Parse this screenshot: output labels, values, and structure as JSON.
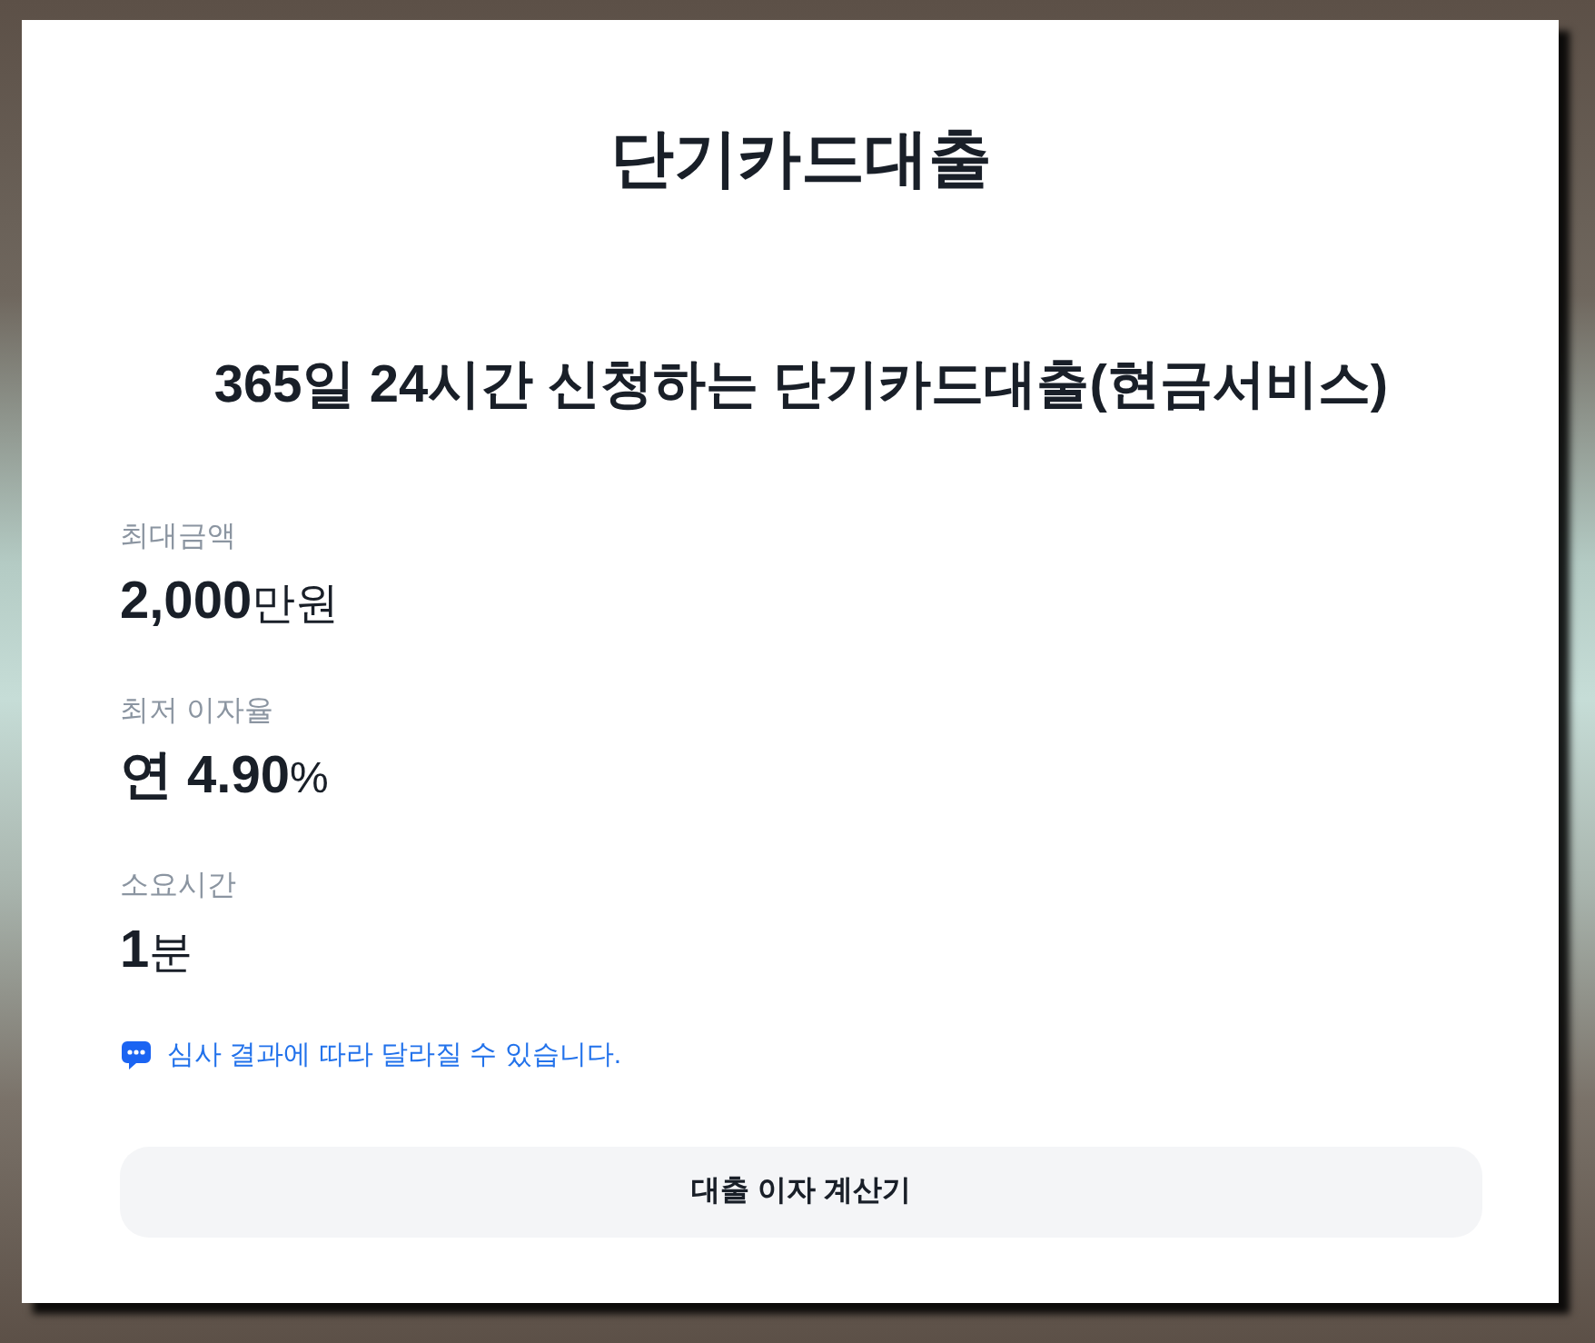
{
  "page": {
    "title": "단기카드대출",
    "subtitle": "365일 24시간 신청하는 단기카드대출(현금서비스)"
  },
  "facts": [
    {
      "label": "최대금액",
      "value": "2,000",
      "unit": "만원"
    },
    {
      "label": "최저 이자율",
      "value": "연 4.90",
      "unit": "%"
    },
    {
      "label": "소요시간",
      "value": "1",
      "unit": "분"
    }
  ],
  "notice": "심사 결과에 따라 달라질 수 있습니다.",
  "button": "대출 이자 계산기"
}
